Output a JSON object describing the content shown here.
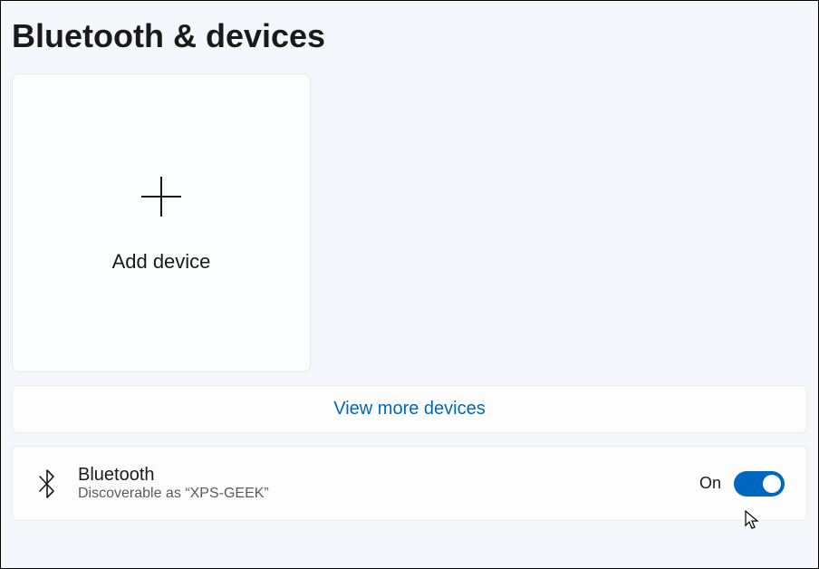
{
  "page": {
    "title": "Bluetooth & devices"
  },
  "addDevice": {
    "label": "Add device"
  },
  "viewMore": {
    "label": "View more devices"
  },
  "bluetooth": {
    "title": "Bluetooth",
    "subtitle": "Discoverable as “XPS-GEEK”",
    "toggleState": "On",
    "toggleOn": true
  }
}
